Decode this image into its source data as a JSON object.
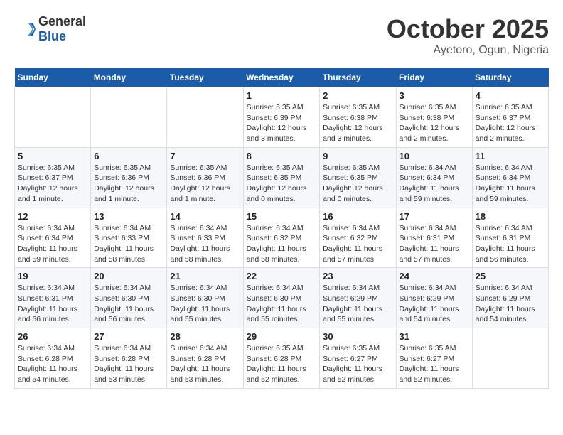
{
  "header": {
    "logo_general": "General",
    "logo_blue": "Blue",
    "month_title": "October 2025",
    "subtitle": "Ayetoro, Ogun, Nigeria"
  },
  "days_of_week": [
    "Sunday",
    "Monday",
    "Tuesday",
    "Wednesday",
    "Thursday",
    "Friday",
    "Saturday"
  ],
  "weeks": [
    [
      {
        "day": "",
        "info": ""
      },
      {
        "day": "",
        "info": ""
      },
      {
        "day": "",
        "info": ""
      },
      {
        "day": "1",
        "info": "Sunrise: 6:35 AM\nSunset: 6:39 PM\nDaylight: 12 hours\nand 3 minutes."
      },
      {
        "day": "2",
        "info": "Sunrise: 6:35 AM\nSunset: 6:38 PM\nDaylight: 12 hours\nand 3 minutes."
      },
      {
        "day": "3",
        "info": "Sunrise: 6:35 AM\nSunset: 6:38 PM\nDaylight: 12 hours\nand 2 minutes."
      },
      {
        "day": "4",
        "info": "Sunrise: 6:35 AM\nSunset: 6:37 PM\nDaylight: 12 hours\nand 2 minutes."
      }
    ],
    [
      {
        "day": "5",
        "info": "Sunrise: 6:35 AM\nSunset: 6:37 PM\nDaylight: 12 hours\nand 1 minute."
      },
      {
        "day": "6",
        "info": "Sunrise: 6:35 AM\nSunset: 6:36 PM\nDaylight: 12 hours\nand 1 minute."
      },
      {
        "day": "7",
        "info": "Sunrise: 6:35 AM\nSunset: 6:36 PM\nDaylight: 12 hours\nand 1 minute."
      },
      {
        "day": "8",
        "info": "Sunrise: 6:35 AM\nSunset: 6:35 PM\nDaylight: 12 hours\nand 0 minutes."
      },
      {
        "day": "9",
        "info": "Sunrise: 6:35 AM\nSunset: 6:35 PM\nDaylight: 12 hours\nand 0 minutes."
      },
      {
        "day": "10",
        "info": "Sunrise: 6:34 AM\nSunset: 6:34 PM\nDaylight: 11 hours\nand 59 minutes."
      },
      {
        "day": "11",
        "info": "Sunrise: 6:34 AM\nSunset: 6:34 PM\nDaylight: 11 hours\nand 59 minutes."
      }
    ],
    [
      {
        "day": "12",
        "info": "Sunrise: 6:34 AM\nSunset: 6:34 PM\nDaylight: 11 hours\nand 59 minutes."
      },
      {
        "day": "13",
        "info": "Sunrise: 6:34 AM\nSunset: 6:33 PM\nDaylight: 11 hours\nand 58 minutes."
      },
      {
        "day": "14",
        "info": "Sunrise: 6:34 AM\nSunset: 6:33 PM\nDaylight: 11 hours\nand 58 minutes."
      },
      {
        "day": "15",
        "info": "Sunrise: 6:34 AM\nSunset: 6:32 PM\nDaylight: 11 hours\nand 58 minutes."
      },
      {
        "day": "16",
        "info": "Sunrise: 6:34 AM\nSunset: 6:32 PM\nDaylight: 11 hours\nand 57 minutes."
      },
      {
        "day": "17",
        "info": "Sunrise: 6:34 AM\nSunset: 6:31 PM\nDaylight: 11 hours\nand 57 minutes."
      },
      {
        "day": "18",
        "info": "Sunrise: 6:34 AM\nSunset: 6:31 PM\nDaylight: 11 hours\nand 56 minutes."
      }
    ],
    [
      {
        "day": "19",
        "info": "Sunrise: 6:34 AM\nSunset: 6:31 PM\nDaylight: 11 hours\nand 56 minutes."
      },
      {
        "day": "20",
        "info": "Sunrise: 6:34 AM\nSunset: 6:30 PM\nDaylight: 11 hours\nand 56 minutes."
      },
      {
        "day": "21",
        "info": "Sunrise: 6:34 AM\nSunset: 6:30 PM\nDaylight: 11 hours\nand 55 minutes."
      },
      {
        "day": "22",
        "info": "Sunrise: 6:34 AM\nSunset: 6:30 PM\nDaylight: 11 hours\nand 55 minutes."
      },
      {
        "day": "23",
        "info": "Sunrise: 6:34 AM\nSunset: 6:29 PM\nDaylight: 11 hours\nand 55 minutes."
      },
      {
        "day": "24",
        "info": "Sunrise: 6:34 AM\nSunset: 6:29 PM\nDaylight: 11 hours\nand 54 minutes."
      },
      {
        "day": "25",
        "info": "Sunrise: 6:34 AM\nSunset: 6:29 PM\nDaylight: 11 hours\nand 54 minutes."
      }
    ],
    [
      {
        "day": "26",
        "info": "Sunrise: 6:34 AM\nSunset: 6:28 PM\nDaylight: 11 hours\nand 54 minutes."
      },
      {
        "day": "27",
        "info": "Sunrise: 6:34 AM\nSunset: 6:28 PM\nDaylight: 11 hours\nand 53 minutes."
      },
      {
        "day": "28",
        "info": "Sunrise: 6:34 AM\nSunset: 6:28 PM\nDaylight: 11 hours\nand 53 minutes."
      },
      {
        "day": "29",
        "info": "Sunrise: 6:35 AM\nSunset: 6:28 PM\nDaylight: 11 hours\nand 52 minutes."
      },
      {
        "day": "30",
        "info": "Sunrise: 6:35 AM\nSunset: 6:27 PM\nDaylight: 11 hours\nand 52 minutes."
      },
      {
        "day": "31",
        "info": "Sunrise: 6:35 AM\nSunset: 6:27 PM\nDaylight: 11 hours\nand 52 minutes."
      },
      {
        "day": "",
        "info": ""
      }
    ]
  ]
}
